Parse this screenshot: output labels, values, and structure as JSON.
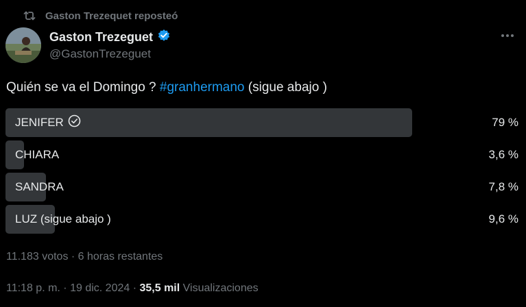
{
  "repost": {
    "text": "Gaston Trezequet reposteó"
  },
  "author": {
    "display_name": "Gaston Trezeguet",
    "handle": "@GastonTrezeguet",
    "verified": true
  },
  "tweet": {
    "text": "Quién se va el Domingo ? ",
    "hashtag": "#granhermano",
    "text_after": " (sigue abajo )"
  },
  "poll": {
    "options": [
      {
        "label": "JENIFER",
        "percent_text": "79 %",
        "value": 79,
        "winner": true
      },
      {
        "label": "CHIARA",
        "percent_text": "3,6 %",
        "value": 3.6,
        "winner": false
      },
      {
        "label": "SANDRA",
        "percent_text": "7,8 %",
        "value": 7.8,
        "winner": false
      },
      {
        "label": "LUZ (sigue abajo )",
        "percent_text": "9,6 %",
        "value": 9.6,
        "winner": false
      }
    ],
    "votes": "11.183 votos",
    "separator": " · ",
    "time_left": "6 horas restantes"
  },
  "meta": {
    "time": "11:18 p. m.",
    "separator": " · ",
    "date": "19 dic. 2024",
    "views_count": "35,5 mil",
    "views_label": " Visualizaciones"
  },
  "colors": {
    "background": "#000000",
    "text": "#e7e9ea",
    "secondary": "#71767b",
    "accent": "#1d9bf0",
    "poll_bar": "#333639"
  },
  "icons": {
    "repost": "repost-icon",
    "verified": "verified-badge-icon",
    "winner": "check-circle-icon",
    "more": "more-icon"
  }
}
